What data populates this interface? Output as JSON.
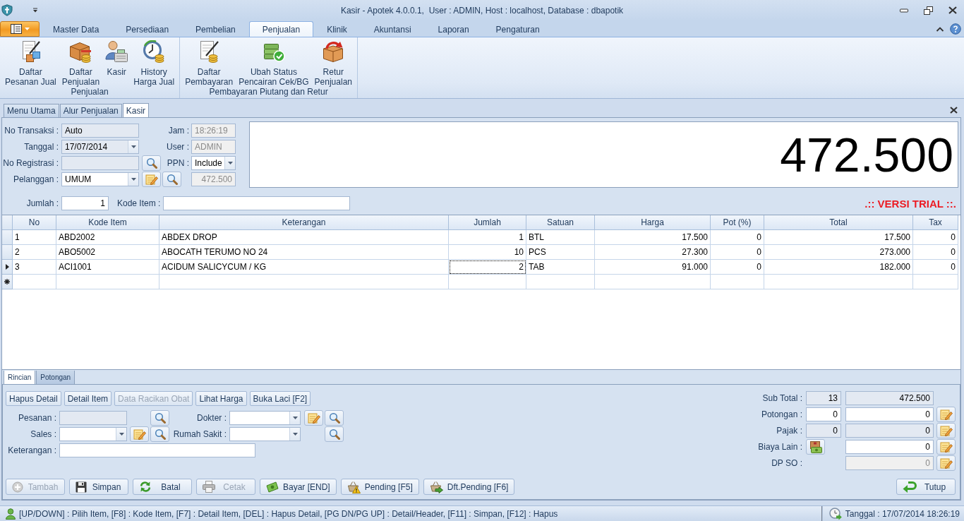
{
  "window": {
    "title": "Kasir - Apotek 4.0.0.1,  User : ADMIN, Host : localhost, Database : dbapotik"
  },
  "ribbon": {
    "tabs": [
      {
        "label": "Master Data",
        "selected": false
      },
      {
        "label": "Persediaan",
        "selected": false
      },
      {
        "label": "Pembelian",
        "selected": false
      },
      {
        "label": "Penjualan",
        "selected": true
      },
      {
        "label": "Klinik",
        "selected": false
      },
      {
        "label": "Akuntansi",
        "selected": false
      },
      {
        "label": "Laporan",
        "selected": false
      },
      {
        "label": "Pengaturan",
        "selected": false
      }
    ],
    "groups": [
      {
        "label": "Penjualan",
        "items": [
          {
            "kind": "order-list",
            "lines": [
              "Daftar",
              "Pesanan Jual"
            ]
          },
          {
            "kind": "sales-list",
            "lines": [
              "Daftar",
              "Penjualan"
            ]
          },
          {
            "kind": "cashier",
            "lines": [
              "Kasir"
            ]
          },
          {
            "kind": "price-history",
            "lines": [
              "History",
              "Harga Jual"
            ]
          }
        ]
      },
      {
        "label": "Pembayaran Piutang dan Retur",
        "items": [
          {
            "kind": "payment-list",
            "lines": [
              "Daftar",
              "Pembayaran"
            ]
          },
          {
            "kind": "check-status",
            "lines": [
              "Ubah Status",
              "Pencairan Cek/BG"
            ]
          },
          {
            "kind": "sales-return",
            "lines": [
              "Retur",
              "Penjualan"
            ]
          }
        ]
      }
    ]
  },
  "document_tabs": [
    {
      "label": "Menu Utama",
      "selected": false
    },
    {
      "label": "Alur Penjualan",
      "selected": false
    },
    {
      "label": "Kasir",
      "selected": true
    }
  ],
  "header": {
    "left": [
      {
        "label": "No Transaksi :",
        "kind": "text",
        "value": "Auto",
        "read_only": true,
        "disabled": false
      },
      {
        "label": "Tanggal :",
        "kind": "dropdown",
        "value": "17/07/2014",
        "read_only": true,
        "disabled": false
      },
      {
        "label": "No Registrasi :",
        "kind": "text",
        "read_only": true,
        "disabled": false,
        "buttons": [
          {
            "kind": "search"
          }
        ]
      },
      {
        "label": "Pelanggan :",
        "kind": "dropdown",
        "value": "UMUM",
        "read_only": false,
        "disabled": false,
        "buttons": [
          {
            "kind": "edit"
          },
          {
            "kind": "search"
          }
        ]
      }
    ],
    "right": [
      {
        "label": "Jam :",
        "kind": "text",
        "value": "18:26:19",
        "read_only": true,
        "disabled": true
      },
      {
        "label": "User :",
        "kind": "text",
        "value": "ADMIN",
        "read_only": true,
        "disabled": true
      },
      {
        "label": "PPN :",
        "kind": "dropdown",
        "value": "Include",
        "read_only": false,
        "disabled": false
      },
      {
        "kind": "number",
        "value": "472.500",
        "read_only": true,
        "disabled": true
      }
    ]
  },
  "display": {
    "amount": "472.500"
  },
  "entry": {
    "fields": [
      {
        "label": "Jumlah :",
        "kind": "number",
        "value": "1",
        "read_only": false,
        "disabled": false
      },
      {
        "label": "Kode Item :",
        "kind": "text",
        "read_only": false,
        "disabled": false
      }
    ],
    "notice": ".:: VERSI TRIAL ::."
  },
  "grid": {
    "columns": [
      {
        "label": "No",
        "kind": "text",
        "focused": false
      },
      {
        "label": "Kode Item",
        "kind": "text",
        "focused": false
      },
      {
        "label": "Keterangan",
        "kind": "text",
        "focused": false
      },
      {
        "label": "Jumlah",
        "kind": "number",
        "focused": true
      },
      {
        "label": "Satuan",
        "kind": "text",
        "focused": false
      },
      {
        "label": "Harga",
        "kind": "number",
        "focused": false
      },
      {
        "label": "Pot (%)",
        "kind": "number",
        "focused": false
      },
      {
        "label": "Total",
        "kind": "number",
        "focused": false
      },
      {
        "label": "Tax",
        "kind": "number",
        "focused": false
      }
    ],
    "rows": [
      {
        "selected": false,
        "cells": [
          "1",
          "ABD2002",
          "ABDEX DROP",
          "1",
          "BTL",
          "17.500",
          "0",
          "17.500",
          "0"
        ]
      },
      {
        "selected": false,
        "cells": [
          "2",
          "ABO5002",
          "ABOCATH TERUMO NO 24",
          "10",
          "PCS",
          "27.300",
          "0",
          "273.000",
          "0"
        ]
      },
      {
        "selected": true,
        "cells": [
          "3",
          "ACI1001",
          "ACIDUM SALICYCUM / KG",
          "2",
          "TAB",
          "91.000",
          "0",
          "182.000",
          "0"
        ]
      }
    ],
    "new_row": true
  },
  "detail_tabs": [
    {
      "label": "Rincian",
      "selected": true
    },
    {
      "label": "Potongan",
      "selected": false
    }
  ],
  "detail": {
    "buttons": [
      {
        "label": "Hapus Detail",
        "disabled": false
      },
      {
        "label": "Detail Item",
        "disabled": false
      },
      {
        "label": "Data Racikan Obat",
        "disabled": true
      },
      {
        "label": "Lihat Harga",
        "disabled": false
      },
      {
        "label": "Buka Laci [F2]",
        "disabled": false
      }
    ],
    "left_fields": [
      {
        "label": "Pesanan :",
        "kind": "text",
        "read_only": true,
        "disabled": false,
        "buttons": [
          {
            "kind": "search"
          }
        ]
      },
      {
        "label": "Sales :",
        "kind": "dropdown",
        "read_only": false,
        "disabled": false,
        "buttons": [
          {
            "kind": "edit"
          },
          {
            "kind": "search"
          }
        ]
      },
      {
        "label": "Keterangan :",
        "kind": "text",
        "read_only": false,
        "disabled": false
      }
    ],
    "right_fields": [
      {
        "label": "Dokter :",
        "kind": "dropdown",
        "read_only": false,
        "disabled": false,
        "buttons": [
          {
            "kind": "edit"
          },
          {
            "kind": "search"
          }
        ]
      },
      {
        "label": "Rumah Sakit :",
        "kind": "dropdown",
        "read_only": false,
        "disabled": false,
        "buttons": [
          {
            "kind": "search"
          }
        ]
      }
    ]
  },
  "totals": [
    {
      "label": "Sub Total :",
      "field_1": {
        "kind": "number",
        "value": "13",
        "read_only": true,
        "disabled": false
      },
      "field_2": {
        "kind": "number",
        "value": "472.500",
        "read_only": true,
        "disabled": false
      },
      "edit_button": false
    },
    {
      "label": "Potongan :",
      "field_1": {
        "kind": "number",
        "value": "0",
        "read_only": false,
        "disabled": false
      },
      "field_2": {
        "kind": "number",
        "value": "0",
        "read_only": false,
        "disabled": false
      },
      "edit_button": true
    },
    {
      "label": "Pajak :",
      "field_1": {
        "kind": "number",
        "value": "0",
        "read_only": true,
        "disabled": false
      },
      "field_2": {
        "kind": "number",
        "value": "0",
        "read_only": true,
        "disabled": false
      },
      "edit_button": true
    },
    {
      "label": "Biaya Lain :",
      "field_1": {
        "kind": "button"
      },
      "field_2": {
        "kind": "number",
        "value": "0",
        "read_only": false,
        "disabled": false
      },
      "edit_button": true
    },
    {
      "label": "DP SO :",
      "field_2": {
        "kind": "number",
        "value": "0",
        "read_only": true,
        "disabled": true
      },
      "edit_button": true
    }
  ],
  "actions": [
    {
      "label": "Tambah",
      "kind": "add",
      "disabled": true
    },
    {
      "label": "Simpan",
      "kind": "save",
      "disabled": false
    },
    {
      "label": "Batal",
      "kind": "cancel",
      "disabled": false
    },
    {
      "label": "Cetak",
      "kind": "print",
      "disabled": true
    },
    {
      "label": "Bayar [END]",
      "kind": "pay",
      "disabled": false
    },
    {
      "label": "Pending [F5]",
      "kind": "pending",
      "disabled": false
    },
    {
      "label": "Dft.Pending [F6]",
      "kind": "pending-list",
      "disabled": false
    }
  ],
  "close_button": {
    "label": "Tutup",
    "kind": "close",
    "disabled": false
  },
  "status_bar": {
    "hint": "[UP/DOWN] : Pilih Item, [F8] : Kode Item, [F7] : Detail Item, [DEL] : Hapus Detail, [PG DN/PG UP] : Detail/Header, [F11] : Simpan, [F12] : Hapus",
    "datetime": "Tanggal : 17/07/2014 18:26:19"
  }
}
